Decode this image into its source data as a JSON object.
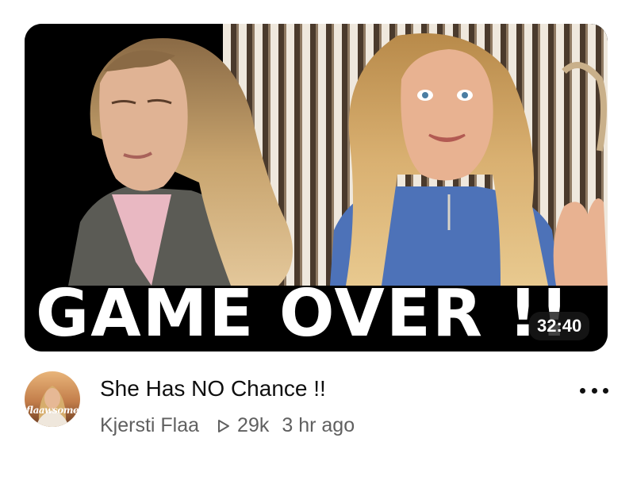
{
  "video": {
    "thumbnail_headline": "GAME OVER !!",
    "duration": "32:40",
    "title": "She Has NO Chance !!",
    "channel": "Kjersti Flaa",
    "views": "29k",
    "published": "3 hr ago",
    "channel_avatar_text": "flaawsome",
    "views_icon": "play-outline-icon",
    "menu_icon": "more-horizontal-icon"
  },
  "colors": {
    "title": "#0f0f0f",
    "secondary": "#606060",
    "duration_badge_bg": "#181818"
  }
}
